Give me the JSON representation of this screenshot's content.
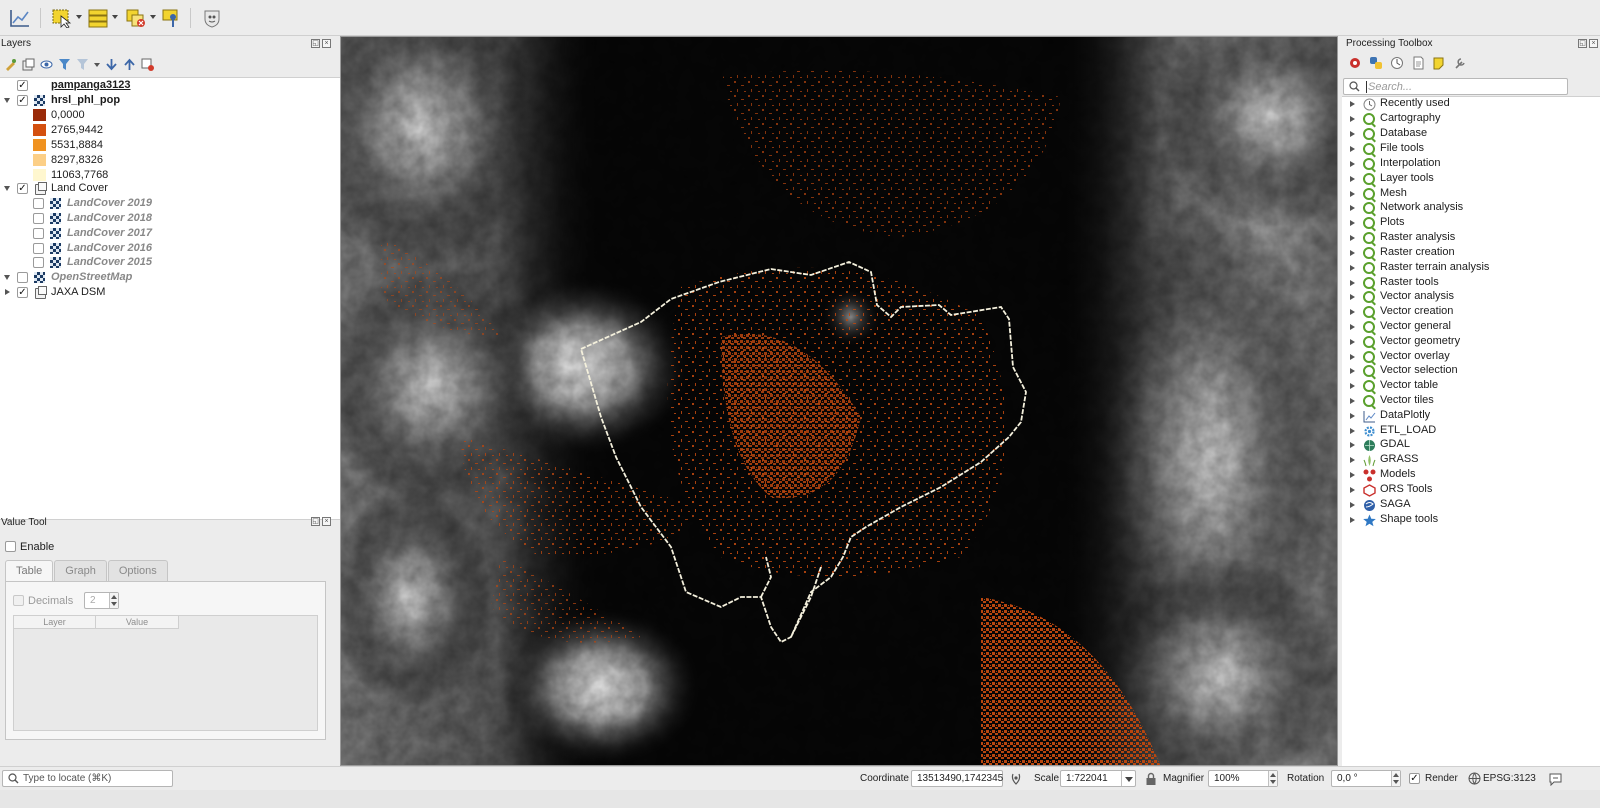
{
  "toolbar": {
    "icons": [
      "dataplotly-icon",
      "select-features-icon",
      "open-attribute-table-icon",
      "deselect-all-icon",
      "identify-features-icon",
      "plugin-icon"
    ]
  },
  "layers_panel": {
    "title": "Layers",
    "items": [
      {
        "label": "pampanga3123",
        "checked": true,
        "style": "bold-underline"
      },
      {
        "label": "hrsl_phl_pop",
        "checked": true,
        "style": "bold",
        "expanded": true
      },
      {
        "label": "Land Cover",
        "checked": true,
        "style": "normal",
        "expanded": true
      },
      {
        "label": "LandCover 2019",
        "checked": false,
        "style": "italic"
      },
      {
        "label": "LandCover 2018",
        "checked": false,
        "style": "italic"
      },
      {
        "label": "LandCover 2017",
        "checked": false,
        "style": "italic"
      },
      {
        "label": "LandCover 2016",
        "checked": false,
        "style": "italic"
      },
      {
        "label": "LandCover 2015",
        "checked": false,
        "style": "italic"
      },
      {
        "label": "OpenStreetMap",
        "checked": false,
        "style": "italic"
      },
      {
        "label": "JAXA DSM",
        "checked": true,
        "style": "normal",
        "expanded": false
      }
    ],
    "legend": [
      {
        "value": "0,0000",
        "color": "#9a2a08"
      },
      {
        "value": "2765,9442",
        "color": "#d4500f"
      },
      {
        "value": "5531,8884",
        "color": "#f0921f"
      },
      {
        "value": "8297,8326",
        "color": "#fccf86"
      },
      {
        "value": "11063,7768",
        "color": "#fff7cf"
      }
    ]
  },
  "value_tool": {
    "title": "Value Tool",
    "enable_label": "Enable",
    "tabs": [
      "Table",
      "Graph",
      "Options"
    ],
    "decimals_label": "Decimals",
    "decimals_value": "2",
    "columns": [
      "Layer",
      "Value"
    ]
  },
  "processing_toolbox": {
    "title": "Processing Toolbox",
    "search_placeholder": "Search...",
    "items": [
      {
        "label": "Recently used",
        "icon": "clock-icon"
      },
      {
        "label": "Cartography",
        "icon": "qgis-icon"
      },
      {
        "label": "Database",
        "icon": "qgis-icon"
      },
      {
        "label": "File tools",
        "icon": "qgis-icon"
      },
      {
        "label": "Interpolation",
        "icon": "qgis-icon"
      },
      {
        "label": "Layer tools",
        "icon": "qgis-icon"
      },
      {
        "label": "Mesh",
        "icon": "qgis-icon"
      },
      {
        "label": "Network analysis",
        "icon": "qgis-icon"
      },
      {
        "label": "Plots",
        "icon": "qgis-icon"
      },
      {
        "label": "Raster analysis",
        "icon": "qgis-icon"
      },
      {
        "label": "Raster creation",
        "icon": "qgis-icon"
      },
      {
        "label": "Raster terrain analysis",
        "icon": "qgis-icon"
      },
      {
        "label": "Raster tools",
        "icon": "qgis-icon"
      },
      {
        "label": "Vector analysis",
        "icon": "qgis-icon"
      },
      {
        "label": "Vector creation",
        "icon": "qgis-icon"
      },
      {
        "label": "Vector general",
        "icon": "qgis-icon"
      },
      {
        "label": "Vector geometry",
        "icon": "qgis-icon"
      },
      {
        "label": "Vector overlay",
        "icon": "qgis-icon"
      },
      {
        "label": "Vector selection",
        "icon": "qgis-icon"
      },
      {
        "label": "Vector table",
        "icon": "qgis-icon"
      },
      {
        "label": "Vector tiles",
        "icon": "qgis-icon"
      },
      {
        "label": "DataPlotly",
        "icon": "dataplotly-icon"
      },
      {
        "label": "ETL_LOAD",
        "icon": "gear-icon"
      },
      {
        "label": "GDAL",
        "icon": "gdal-icon"
      },
      {
        "label": "GRASS",
        "icon": "grass-icon"
      },
      {
        "label": "Models",
        "icon": "models-icon"
      },
      {
        "label": "ORS Tools",
        "icon": "ors-icon"
      },
      {
        "label": "SAGA",
        "icon": "saga-icon"
      },
      {
        "label": "Shape tools",
        "icon": "shape-tools-icon"
      }
    ]
  },
  "statusbar": {
    "locate_placeholder": "Type to locate (⌘K)",
    "coordinate_label": "Coordinate",
    "coordinate_value": "13513490,1742345",
    "scale_label": "Scale",
    "scale_value": "1:722041",
    "magnifier_label": "Magnifier",
    "magnifier_value": "100%",
    "rotation_label": "Rotation",
    "rotation_value": "0,0 °",
    "render_label": "Render",
    "render_checked": true,
    "crs_label": "EPSG:3123"
  },
  "colors": {
    "population": "#b8460f",
    "boundary": "#f4f0dc",
    "map_background": "#070707"
  }
}
